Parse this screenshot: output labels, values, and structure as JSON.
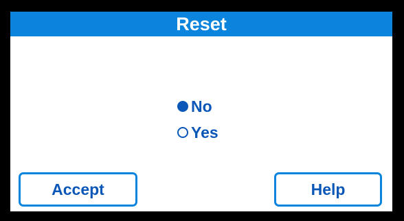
{
  "dialog": {
    "title": "Reset",
    "selected": "No"
  },
  "options": [
    {
      "label": "No",
      "checked": true
    },
    {
      "label": "Yes",
      "checked": false
    }
  ],
  "buttons": {
    "accept_label": "Accept",
    "help_label": "Help"
  },
  "colors": {
    "title_bar": "#0a84dc",
    "text_blue": "#0a57b8",
    "bezel": "#000000"
  }
}
